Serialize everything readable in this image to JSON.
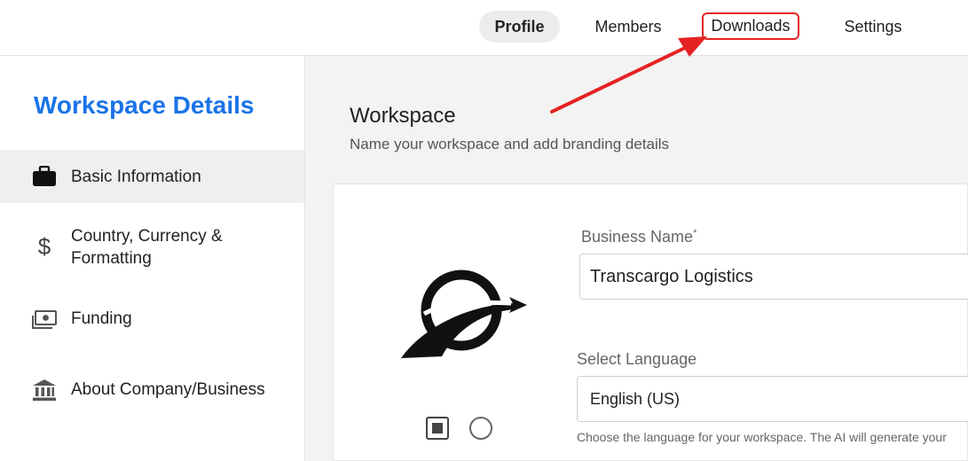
{
  "nav": {
    "tabs": [
      {
        "label": "Profile",
        "active": true
      },
      {
        "label": "Members",
        "active": false
      },
      {
        "label": "Downloads",
        "active": false,
        "highlighted": true
      },
      {
        "label": "Settings",
        "active": false
      }
    ]
  },
  "sidebar": {
    "title": "Workspace Details",
    "items": [
      {
        "label": "Basic Information",
        "icon": "briefcase-icon",
        "active": true
      },
      {
        "label": "Country, Currency &",
        "label_line2": "Formatting",
        "icon": "dollar-icon",
        "active": false
      },
      {
        "label": "Funding",
        "icon": "money-icon",
        "active": false
      },
      {
        "label": "About Company/Business",
        "icon": "bank-icon",
        "active": false
      }
    ]
  },
  "main": {
    "title": "Workspace",
    "subtitle": "Name your workspace and add branding details",
    "business_name": {
      "label": "Business Name",
      "required_mark": "*",
      "value": "Transcargo Logistics"
    },
    "language": {
      "label": "Select Language",
      "value": "English (US)",
      "hint": "Choose the language for your workspace. The AI will generate your"
    }
  },
  "colors": {
    "accent": "#1a73e8",
    "annotation": "#e52222"
  }
}
